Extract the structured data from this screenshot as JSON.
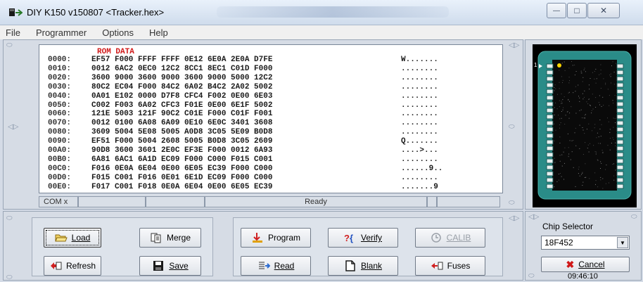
{
  "window": {
    "title": "DIY K150 v150807  <Tracker.hex>",
    "buttons": {
      "minimize": "—",
      "maximize": "□",
      "close": "✕"
    }
  },
  "menu": [
    "File",
    "Programmer",
    "Options",
    "Help"
  ],
  "hex": {
    "header": "ROM DATA",
    "rows": [
      {
        "addr": "0000:",
        "bytes": "EF57 F000 FFFF FFFF 0E12 6E0A 2E0A D7FE",
        "ascii": "W......."
      },
      {
        "addr": "0010:",
        "bytes": "0012 6AC2 0EC0 12C2 8CC1 8EC1 C01D F000",
        "ascii": "........"
      },
      {
        "addr": "0020:",
        "bytes": "3600 9000 3600 9000 3600 9000 5000 12C2",
        "ascii": "........"
      },
      {
        "addr": "0030:",
        "bytes": "80C2 EC04 F000 84C2 6A02 B4C2 2A02 5002",
        "ascii": "........"
      },
      {
        "addr": "0040:",
        "bytes": "0A01 E102 0000 D7F8 CFC4 F002 0E00 6E03",
        "ascii": "........"
      },
      {
        "addr": "0050:",
        "bytes": "C002 F003 6A02 CFC3 F01E 0E00 6E1F 5002",
        "ascii": "........"
      },
      {
        "addr": "0060:",
        "bytes": "121E 5003 121F 90C2 C01E F000 C01F F001",
        "ascii": "........"
      },
      {
        "addr": "0070:",
        "bytes": "0012 0100 6A08 6A09 0E10 6E0C 3401 3608",
        "ascii": "........"
      },
      {
        "addr": "0080:",
        "bytes": "3609 5004 5E08 5005 A0D8 3C05 5E09 B0D8",
        "ascii": "........"
      },
      {
        "addr": "0090:",
        "bytes": "EF51 F000 5004 2608 5005 B0D8 3C05 2609",
        "ascii": "Q......."
      },
      {
        "addr": "00A0:",
        "bytes": "90D8 3600 3601 2E0C EF3E F000 0012 6A93",
        "ascii": "....>..."
      },
      {
        "addr": "00B0:",
        "bytes": "6A81 6AC1 6A1D EC09 F000 C000 F015 C001",
        "ascii": "........"
      },
      {
        "addr": "00C0:",
        "bytes": "F016 0E0A 6E04 0E00 6E05 EC39 F000 C000",
        "ascii": "......9.."
      },
      {
        "addr": "00D0:",
        "bytes": "F015 C001 F016 0E01 6E1D EC09 F000 C000",
        "ascii": "........"
      },
      {
        "addr": "00E0:",
        "bytes": "F017 C001 F018 0E0A 6E04 0E00 6E05 EC39",
        "ascii": ".......9"
      }
    ]
  },
  "status": {
    "port": "COM x",
    "message": "Ready"
  },
  "buttons": {
    "load": "Load",
    "merge": "Merge",
    "refresh": "Refresh",
    "save": "Save",
    "program": "Program",
    "verify": "Verify",
    "calib": "CALIB",
    "read": "Read",
    "blank": "Blank",
    "fuses": "Fuses"
  },
  "chip_selector": {
    "label": "Chip Selector",
    "selected": "18F452",
    "cancel": "Cancel",
    "time": "09:46:10"
  },
  "chip_pin_label": "1",
  "colors": {
    "accent_teal": "#2a8c88",
    "hex_header_red": "#d01818",
    "cancel_red": "#d01818"
  }
}
